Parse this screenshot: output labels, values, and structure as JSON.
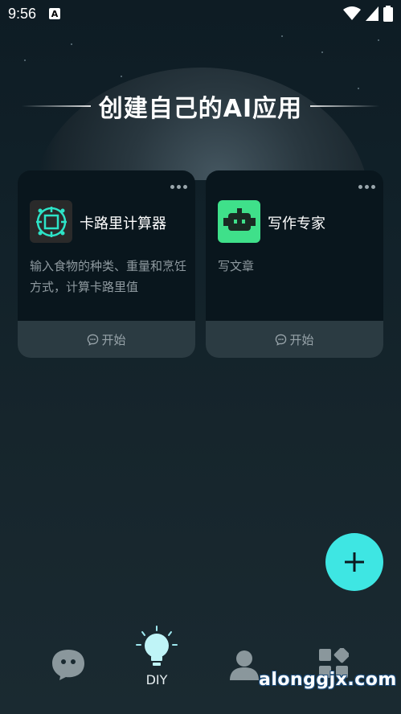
{
  "status_bar": {
    "time": "9:56",
    "notification_badge": "A"
  },
  "hero": {
    "title": "创建自己的AI应用"
  },
  "cards": [
    {
      "name": "卡路里计算器",
      "description": "输入食物的种类、重量和烹饪方式，计算卡路里值",
      "start_label": "开始",
      "icon": "chip-icon"
    },
    {
      "name": "写作专家",
      "description": "写文章",
      "start_label": "开始",
      "icon": "robot-icon"
    }
  ],
  "fab": {
    "icon": "plus-icon"
  },
  "nav": {
    "items": [
      {
        "icon": "chat-bubble-icon",
        "label": ""
      },
      {
        "icon": "lightbulb-icon",
        "label": "DIY",
        "active": true
      },
      {
        "icon": "user-icon",
        "label": ""
      },
      {
        "icon": "apps-grid-icon",
        "label": ""
      }
    ]
  },
  "watermark": "alonggjx.com",
  "colors": {
    "accent": "#3ee6e3",
    "card_bg": "#09161d",
    "card_footer_bg": "#2b3b42",
    "writer_icon_bg": "#3fe08a"
  }
}
